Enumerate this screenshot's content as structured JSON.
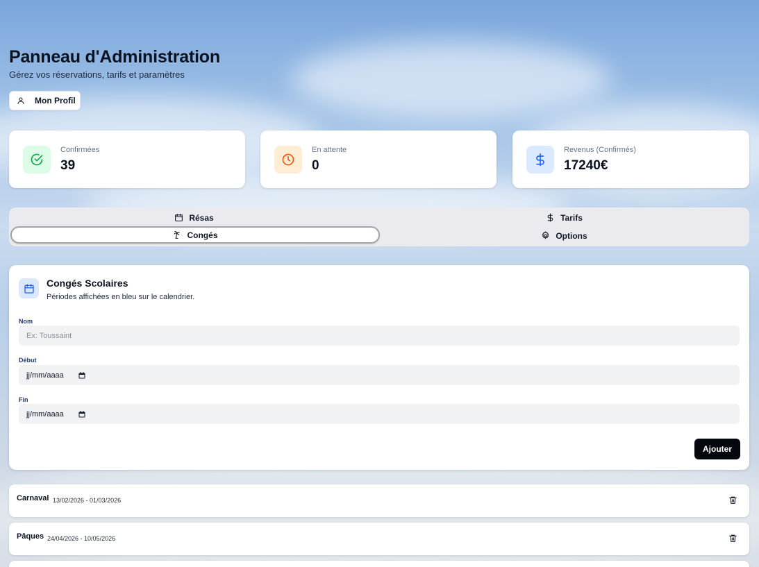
{
  "header": {
    "title": "Panneau d'Administration",
    "subtitle": "Gérez vos réservations, tarifs et paramètres",
    "profile_button": "Mon Profil",
    "profile_icon": "user-icon"
  },
  "stats": [
    {
      "label": "Confirmées",
      "value": "39",
      "icon": "check-circle-icon",
      "color": "#16a34a",
      "bg": "#dcfce7"
    },
    {
      "label": "En attente",
      "value": "0",
      "icon": "clock-icon",
      "color": "#ea580c",
      "bg": "#ffedd5"
    },
    {
      "label": "Revenus (Confirmés)",
      "value": "17240€",
      "icon": "dollar-icon",
      "color": "#2563eb",
      "bg": "#dbeafe"
    }
  ],
  "tabs": [
    {
      "label": "Résas",
      "icon": "calendar-icon",
      "active": false
    },
    {
      "label": "Tarifs",
      "icon": "dollar-icon",
      "active": false
    },
    {
      "label": "Congés",
      "icon": "palm-tree-icon",
      "active": true
    },
    {
      "label": "Options",
      "icon": "gear-icon",
      "active": false
    }
  ],
  "holidays_form": {
    "title": "Congés Scolaires",
    "description": "Périodes affichées en bleu sur le calendrier.",
    "name_label": "Nom",
    "name_placeholder": "Ex: Toussaint",
    "start_label": "Début",
    "start_value": "jj/mm/aaaa",
    "end_label": "Fin",
    "end_value": "jj/mm/aaaa",
    "submit_label": "Ajouter"
  },
  "holidays": [
    {
      "name": "Carnaval",
      "dates": "13/02/2026 - 01/03/2026"
    },
    {
      "name": "Pâques",
      "dates": "24/04/2026 - 10/05/2026"
    }
  ],
  "colors": {
    "accent_blue": "#2563eb",
    "primary_button": "#05070f",
    "tab_bar": "#ebebef"
  }
}
